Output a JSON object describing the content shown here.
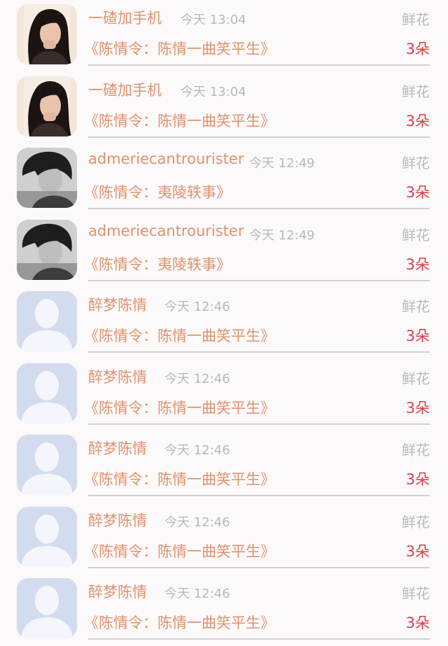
{
  "gift_label": "鲜花",
  "items": [
    {
      "avatar": "girl-avatar",
      "name": "一碴加手机",
      "time": "今天 13:04",
      "title": "《陈情令：陈情一曲笑平生》",
      "count": "3朵"
    },
    {
      "avatar": "girl-avatar",
      "name": "一碴加手机",
      "time": "今天 13:04",
      "title": "《陈情令：陈情一曲笑平生》",
      "count": "3朵"
    },
    {
      "avatar": "boy-avatar",
      "name": "admeriecantrourister",
      "time": "今天 12:49",
      "title": "《陈情令：夷陵轶事》",
      "count": "3朵"
    },
    {
      "avatar": "boy-avatar",
      "name": "admeriecantrourister",
      "time": "今天 12:49",
      "title": "《陈情令：夷陵轶事》",
      "count": "3朵"
    },
    {
      "avatar": "default-avatar",
      "name": "醉梦陈情",
      "time": "今天 12:46",
      "title": "《陈情令：陈情一曲笑平生》",
      "count": "3朵"
    },
    {
      "avatar": "default-avatar",
      "name": "醉梦陈情",
      "time": "今天 12:46",
      "title": "《陈情令：陈情一曲笑平生》",
      "count": "3朵"
    },
    {
      "avatar": "default-avatar",
      "name": "醉梦陈情",
      "time": "今天 12:46",
      "title": "《陈情令：陈情一曲笑平生》",
      "count": "3朵"
    },
    {
      "avatar": "default-avatar",
      "name": "醉梦陈情",
      "time": "今天 12:46",
      "title": "《陈情令：陈情一曲笑平生》",
      "count": "3朵"
    },
    {
      "avatar": "default-avatar",
      "name": "醉梦陈情",
      "time": "今天 12:46",
      "title": "《陈情令：陈情一曲笑平生》",
      "count": "3朵"
    }
  ]
}
